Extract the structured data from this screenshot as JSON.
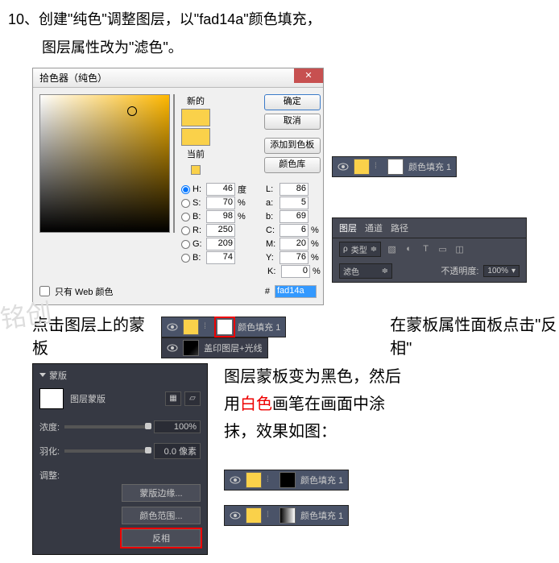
{
  "step_num": "10、",
  "instruction_line1_a": "创建\"纯色\"调整图层，以\"",
  "instruction_line1_hex": "fad14a",
  "instruction_line1_b": "\"颜色填充，",
  "instruction_line2": "图层属性改为\"滤色\"。",
  "color_picker": {
    "title": "拾色器（纯色）",
    "new_label": "新的",
    "current_label": "当前",
    "btn_ok": "确定",
    "btn_cancel": "取消",
    "btn_add": "添加到色板",
    "btn_lib": "颜色库",
    "web_only": "只有 Web 颜色",
    "fields": {
      "H": {
        "v": "46",
        "u": "度"
      },
      "S": {
        "v": "70",
        "u": "%"
      },
      "B": {
        "v": "98",
        "u": "%"
      },
      "R": {
        "v": "250"
      },
      "G": {
        "v": "209"
      },
      "Bb": {
        "v": "74"
      },
      "L": {
        "v": "86"
      },
      "a": {
        "v": "5"
      },
      "b": {
        "v": "69"
      },
      "C": {
        "v": "6",
        "u": "%"
      },
      "M": {
        "v": "20",
        "u": "%"
      },
      "Y": {
        "v": "76",
        "u": "%"
      },
      "K": {
        "v": "0",
        "u": "%"
      }
    },
    "hex": "fad14a"
  },
  "layer_fill_1": "颜色填充 1",
  "layer_stamp": "盖印图层+光线",
  "layers_panel": {
    "tab1": "图层",
    "tab2": "通道",
    "tab3": "路径",
    "kind": "类型",
    "blend": "滤色",
    "opacity_label": "不透明度:",
    "opacity_val": "100%"
  },
  "text_click_mask": "点击图层上的蒙板",
  "text_click_invert": "在蒙板属性面板点击\"反相\"",
  "mask_panel": {
    "title": "蒙版",
    "thumb_label": "图层蒙版",
    "density": "浓度:",
    "density_val": "100%",
    "feather": "羽化:",
    "feather_val": "0.0 像素",
    "adjust": "调整:",
    "btn_edge": "蒙版边缘...",
    "btn_range": "颜色范围...",
    "btn_invert": "反相"
  },
  "text_result_1": "图层蒙板变为黑色，然后",
  "text_result_2a": "用",
  "text_result_2b": "白色",
  "text_result_2c": "画笔在画面中涂",
  "text_result_3": "抹，效果如图："
}
